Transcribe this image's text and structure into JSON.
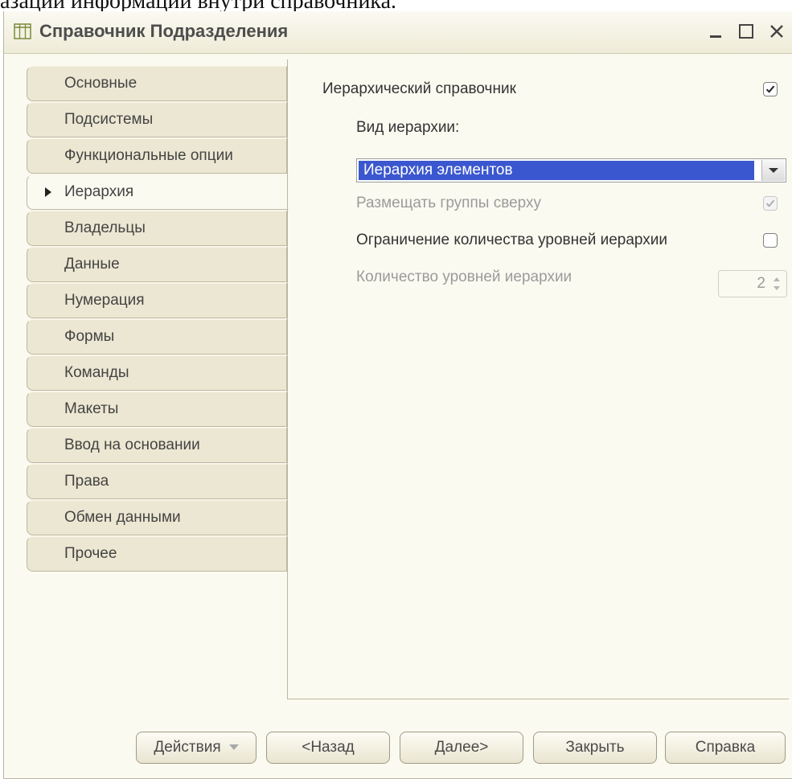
{
  "caption_fragment": "азации информации внутри справочника.",
  "window": {
    "title": "Справочник Подразделения",
    "controls": [
      "minimize",
      "maximize",
      "close"
    ]
  },
  "nav": {
    "active_index": 3,
    "items": [
      {
        "label": "Основные"
      },
      {
        "label": "Подсистемы"
      },
      {
        "label": "Функциональные опции"
      },
      {
        "label": "Иерархия"
      },
      {
        "label": "Владельцы"
      },
      {
        "label": "Данные"
      },
      {
        "label": "Нумерация"
      },
      {
        "label": "Формы"
      },
      {
        "label": "Команды"
      },
      {
        "label": "Макеты"
      },
      {
        "label": "Ввод на основании"
      },
      {
        "label": "Права"
      },
      {
        "label": "Обмен данными"
      },
      {
        "label": "Прочее"
      }
    ]
  },
  "hierarchy": {
    "hierarchical_label": "Иерархический справочник",
    "hierarchical_checked": true,
    "kind_label": "Вид иерархии:",
    "kind_value": "Иерархия элементов",
    "groups_on_top_label": "Размещать группы сверху",
    "groups_on_top_checked": true,
    "groups_on_top_enabled": false,
    "limit_levels_label": "Ограничение количества уровней иерархии",
    "limit_levels_checked": false,
    "levels_count_label": "Количество уровней иерархии",
    "levels_count_value": "2",
    "levels_count_enabled": false
  },
  "buttons": {
    "actions": "Действия",
    "back": "<Назад",
    "next": "Далее>",
    "close": "Закрыть",
    "help": "Справка"
  },
  "colors": {
    "window_bg": "#fbfaf0",
    "tab_bg": "#ece7d2",
    "selection": "#3b57cf"
  }
}
